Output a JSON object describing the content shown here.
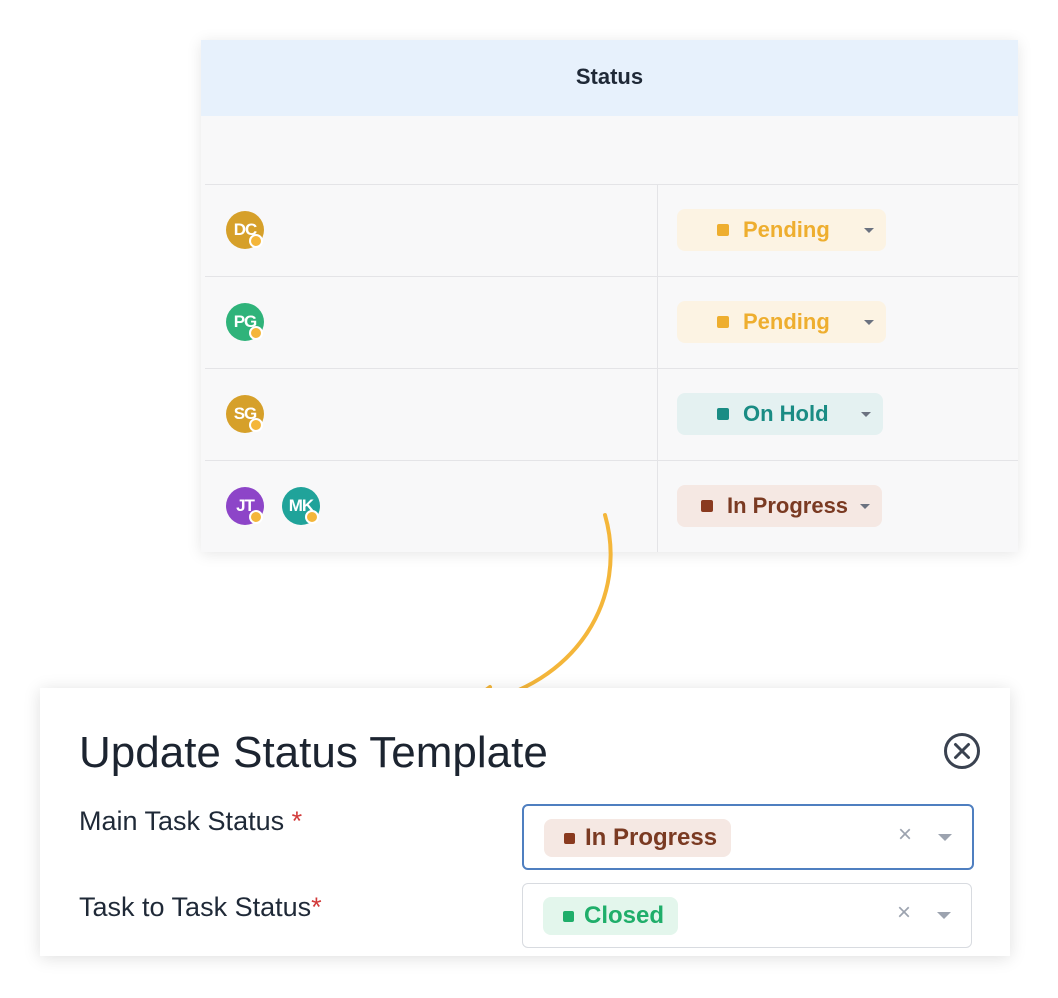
{
  "table": {
    "header": "Status",
    "rows": [
      {
        "avatars": [
          {
            "initials": "DC",
            "color": "#d6a02a"
          }
        ],
        "status": {
          "label": "Pending",
          "text_color": "#eeae2f",
          "bg": "#fcf3e3",
          "square": "#eeae2f"
        }
      },
      {
        "avatars": [
          {
            "initials": "PG",
            "color": "#2fb37a"
          }
        ],
        "status": {
          "label": "Pending",
          "text_color": "#eeae2f",
          "bg": "#fcf3e3",
          "square": "#eeae2f"
        }
      },
      {
        "avatars": [
          {
            "initials": "SG",
            "color": "#d6a02a"
          }
        ],
        "status": {
          "label": "On Hold",
          "text_color": "#1a8c84",
          "bg": "#e4f1f1",
          "square": "#1a8c84"
        }
      },
      {
        "avatars": [
          {
            "initials": "JT",
            "color": "#8d45c8"
          },
          {
            "initials": "MK",
            "color": "#20a39a"
          }
        ],
        "status": {
          "label": "In Progress",
          "text_color": "#7a3a22",
          "bg": "#f5e8e3",
          "square": "#8a3a1f"
        }
      }
    ]
  },
  "modal": {
    "title": "Update Status Template",
    "close_icon": "circle-x-icon",
    "fields": [
      {
        "label": "Main Task Status",
        "required_mark": " *",
        "value": "In Progress",
        "chip_text_color": "#7a3a22",
        "chip_bg": "#f5e8e3",
        "chip_square": "#8a3a1f",
        "clear": "×"
      },
      {
        "label": "Task to Task Status",
        "required_mark": "*",
        "value": "Closed",
        "chip_text_color": "#1fae6a",
        "chip_bg": "#e3f6ec",
        "chip_square": "#1fae6a",
        "clear": "×"
      }
    ]
  },
  "arrow_color": "#f4b63a"
}
